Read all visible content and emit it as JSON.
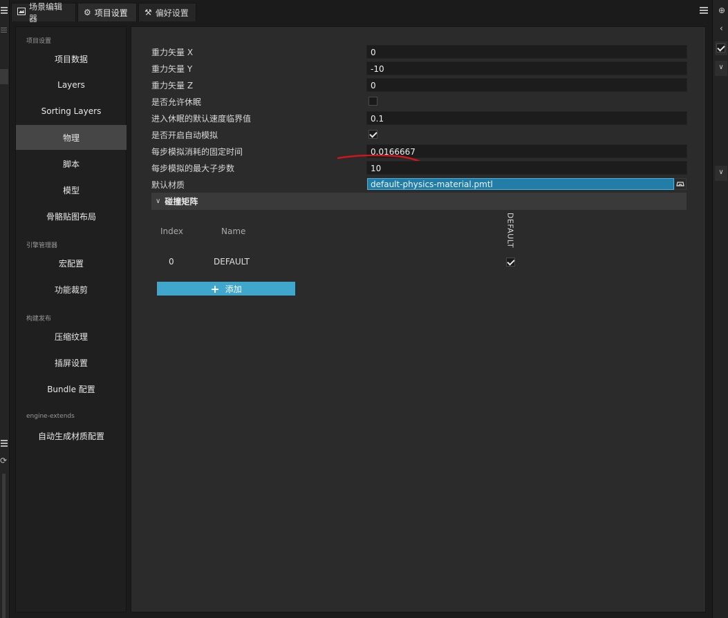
{
  "tabs": [
    {
      "label": "场景编辑器",
      "icon": "scene-editor-icon"
    },
    {
      "label": "项目设置",
      "icon": "gear-icon"
    },
    {
      "label": "偏好设置",
      "icon": "tools-icon"
    }
  ],
  "sidebar": {
    "sections": [
      {
        "title": "项目设置"
      },
      {
        "title": "引擎管理器"
      },
      {
        "title": "构建发布"
      },
      {
        "title": "engine-extends"
      }
    ],
    "items": [
      {
        "label": "项目数据"
      },
      {
        "label": "Layers"
      },
      {
        "label": "Sorting Layers"
      },
      {
        "label": "物理"
      },
      {
        "label": "脚本"
      },
      {
        "label": "模型"
      },
      {
        "label": "骨骼贴图布局"
      },
      {
        "label": "宏配置"
      },
      {
        "label": "功能裁剪"
      },
      {
        "label": "压缩纹理"
      },
      {
        "label": "插屏设置"
      },
      {
        "label": "Bundle 配置"
      },
      {
        "label": "自动生成材质配置"
      }
    ],
    "active_item": "物理"
  },
  "physics": {
    "rows": [
      {
        "label": "重力矢量 X",
        "value": "0"
      },
      {
        "label": "重力矢量 Y",
        "value": "-10"
      },
      {
        "label": "重力矢量 Z",
        "value": "0"
      },
      {
        "label": "是否允许休眠",
        "checked": false
      },
      {
        "label": "进入休眠的默认速度临界值",
        "value": "0.1"
      },
      {
        "label": "是否开启自动模拟",
        "checked": true
      },
      {
        "label": "每步模拟消耗的固定时间",
        "value": "0.0166667"
      },
      {
        "label": "每步模拟的最大子步数",
        "value": "10"
      },
      {
        "label": "默认材质",
        "value": "default-physics-material.pmtl"
      }
    ],
    "collision_matrix": {
      "title": "碰撞矩阵",
      "headers": {
        "index": "Index",
        "name": "Name"
      },
      "column_groups": [
        "DEFAULT"
      ],
      "groups": [
        {
          "index": "0",
          "name": "DEFAULT",
          "checked": true
        }
      ],
      "add_label": "添加"
    }
  },
  "colors": {
    "accent": "#3fa6cc",
    "asset_field": "#227da7",
    "annotation": "#d0161c",
    "active_nav": "#464646"
  }
}
